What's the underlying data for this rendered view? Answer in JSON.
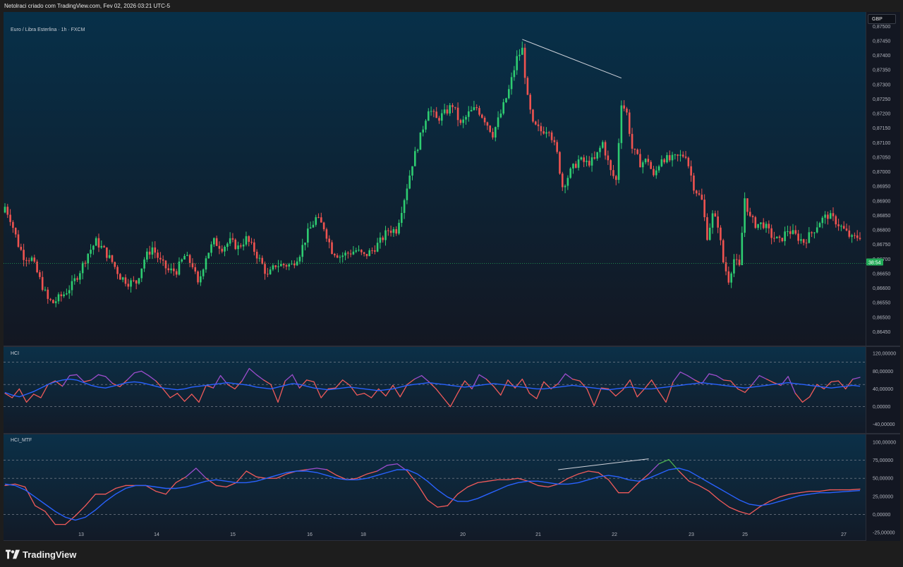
{
  "header": {
    "snapshot_text": "Netolraci criado com TradingView.com, Fev 02, 2026 03:21 UTC-5",
    "symbol_text": "Euro / Libra Esterlina · 1h · FXCM",
    "currency": "GBP"
  },
  "brand": {
    "name": "TradingView",
    "icon": "tradingview-logo-icon"
  },
  "colors": {
    "up": "#26a69a",
    "up_bright": "#2ecc71",
    "down": "#ef5350",
    "hci_line": "#f05a5a",
    "hci_purple": "#9c4dcc",
    "hci_green": "#4caf50",
    "signal_blue": "#2962ff",
    "price_label_bg": "#22ab58"
  },
  "chart_data": [
    {
      "type": "candlestick",
      "title": "Euro / Libra Esterlina · 1h · FXCM",
      "ylabel": "GBP",
      "ylim": [
        0.8641,
        0.8752
      ],
      "y_ticks": [
        "0,87500",
        "0,87450",
        "0,87400",
        "0,87350",
        "0,87300",
        "0,87250",
        "0,87200",
        "0,87150",
        "0,87100",
        "0,87050",
        "0,87000",
        "0,86950",
        "0,86900",
        "0,86850",
        "0,86800",
        "0,86750",
        "0,86700",
        "0,86650",
        "0,86600",
        "0,86550",
        "0,86500",
        "0,86450"
      ],
      "x_ticks": [
        "13",
        "14",
        "15",
        "16",
        "18",
        "20",
        "21",
        "22",
        "23",
        "25",
        "27"
      ],
      "current_price_line": 0.86685,
      "countdown_label": "38:54",
      "trendline": {
        "from": 0.87455,
        "to": 0.87322
      },
      "anchor_closes": [
        [
          0,
          0.8688
        ],
        [
          2,
          0.8684
        ],
        [
          5,
          0.8675
        ],
        [
          7,
          0.8671
        ],
        [
          10,
          0.867
        ],
        [
          13,
          0.8663
        ],
        [
          16,
          0.8656
        ],
        [
          18,
          0.8655
        ],
        [
          22,
          0.8658
        ],
        [
          25,
          0.8661
        ],
        [
          28,
          0.8666
        ],
        [
          31,
          0.8672
        ],
        [
          34,
          0.8676
        ],
        [
          37,
          0.8673
        ],
        [
          40,
          0.8669
        ],
        [
          43,
          0.8664
        ],
        [
          46,
          0.8662
        ],
        [
          49,
          0.8662
        ],
        [
          52,
          0.867
        ],
        [
          55,
          0.8674
        ],
        [
          58,
          0.8669
        ],
        [
          61,
          0.8666
        ],
        [
          64,
          0.8666
        ],
        [
          67,
          0.8671
        ],
        [
          70,
          0.8668
        ],
        [
          72,
          0.8661
        ],
        [
          75,
          0.8671
        ],
        [
          78,
          0.8676
        ],
        [
          81,
          0.8674
        ],
        [
          84,
          0.8676
        ],
        [
          87,
          0.8674
        ],
        [
          90,
          0.8677
        ],
        [
          93,
          0.8673
        ],
        [
          96,
          0.8668
        ],
        [
          98,
          0.8664
        ],
        [
          101,
          0.8668
        ],
        [
          104,
          0.8668
        ],
        [
          107,
          0.8668
        ],
        [
          110,
          0.8672
        ],
        [
          113,
          0.8679
        ],
        [
          116,
          0.8684
        ],
        [
          119,
          0.8681
        ],
        [
          122,
          0.8673
        ],
        [
          125,
          0.8671
        ],
        [
          128,
          0.8672
        ],
        [
          131,
          0.8673
        ],
        [
          134,
          0.8671
        ],
        [
          137,
          0.8673
        ],
        [
          140,
          0.8676
        ],
        [
          143,
          0.868
        ],
        [
          146,
          0.868
        ],
        [
          149,
          0.8691
        ],
        [
          152,
          0.8703
        ],
        [
          155,
          0.8712
        ],
        [
          158,
          0.8722
        ],
        [
          161,
          0.8718
        ],
        [
          164,
          0.872
        ],
        [
          167,
          0.8723
        ],
        [
          170,
          0.8716
        ],
        [
          173,
          0.872
        ],
        [
          176,
          0.8722
        ],
        [
          179,
          0.8718
        ],
        [
          182,
          0.8713
        ],
        [
          185,
          0.872
        ],
        [
          188,
          0.8728
        ],
        [
          191,
          0.8739
        ],
        [
          193,
          0.8742
        ],
        [
          195,
          0.8725
        ],
        [
          197,
          0.8716
        ],
        [
          200,
          0.8714
        ],
        [
          203,
          0.8715
        ],
        [
          206,
          0.8706
        ],
        [
          208,
          0.8695
        ],
        [
          211,
          0.87
        ],
        [
          214,
          0.8704
        ],
        [
          217,
          0.8703
        ],
        [
          220,
          0.8704
        ],
        [
          223,
          0.871
        ],
        [
          226,
          0.87
        ],
        [
          228,
          0.8697
        ],
        [
          230,
          0.8724
        ],
        [
          232,
          0.872
        ],
        [
          234,
          0.8708
        ],
        [
          237,
          0.8703
        ],
        [
          240,
          0.8704
        ],
        [
          242,
          0.8698
        ],
        [
          245,
          0.8705
        ],
        [
          248,
          0.8704
        ],
        [
          251,
          0.8705
        ],
        [
          254,
          0.8706
        ],
        [
          257,
          0.8695
        ],
        [
          260,
          0.869
        ],
        [
          262,
          0.8678
        ],
        [
          264,
          0.8685
        ],
        [
          266,
          0.8682
        ],
        [
          268,
          0.8669
        ],
        [
          270,
          0.8663
        ],
        [
          272,
          0.867
        ],
        [
          274,
          0.8667
        ],
        [
          276,
          0.8691
        ],
        [
          278,
          0.8684
        ],
        [
          280,
          0.8682
        ],
        [
          283,
          0.8682
        ],
        [
          286,
          0.8678
        ],
        [
          289,
          0.8676
        ],
        [
          292,
          0.868
        ],
        [
          295,
          0.8678
        ],
        [
          298,
          0.8676
        ],
        [
          301,
          0.8679
        ],
        [
          304,
          0.8683
        ],
        [
          307,
          0.8685
        ],
        [
          310,
          0.8683
        ],
        [
          313,
          0.868
        ],
        [
          316,
          0.8677
        ],
        [
          319,
          0.8678
        ]
      ]
    },
    {
      "type": "line",
      "title": "HCI",
      "ylim": [
        -50,
        125
      ],
      "y_ticks": [
        "120,00000",
        "80,00000",
        "40,00000",
        "0,00000",
        "-40,00000"
      ],
      "levels": [
        100,
        50,
        0
      ],
      "series": [
        {
          "name": "",
          "color": "#f05a5a",
          "values": [
            30,
            20,
            40,
            10,
            28,
            20,
            50,
            58,
            46,
            70,
            72,
            56,
            60,
            72,
            68,
            52,
            45,
            60,
            76,
            80,
            70,
            58,
            40,
            20,
            30,
            12,
            28,
            10,
            48,
            42,
            70,
            50,
            40,
            58,
            86,
            72,
            60,
            50,
            10,
            58,
            72,
            42,
            60,
            56,
            20,
            40,
            42,
            60,
            48,
            26,
            30,
            20,
            40,
            24,
            48,
            22,
            50,
            62,
            70,
            56,
            40,
            20,
            0,
            30,
            58,
            40,
            72,
            62,
            46,
            26,
            60,
            42,
            62,
            30,
            18,
            56,
            40,
            52,
            74,
            62,
            58,
            40,
            2,
            42,
            40,
            24,
            38,
            60,
            22,
            40,
            60,
            34,
            10,
            56,
            78,
            70,
            60,
            52,
            74,
            70,
            60,
            58,
            40,
            32,
            50,
            70,
            62,
            54,
            48,
            68,
            30,
            10,
            22,
            50,
            40,
            56,
            58,
            40,
            62,
            66
          ]
        },
        {
          "name": "",
          "color": "#2962ff",
          "values": [
            32,
            26,
            22,
            28,
            34,
            42,
            50,
            56,
            60,
            62,
            60,
            54,
            48,
            44,
            42,
            46,
            50,
            54,
            56,
            54,
            50,
            46,
            42,
            40,
            38,
            40,
            44,
            46,
            48,
            50,
            52,
            54,
            52,
            50,
            48,
            44,
            42,
            40,
            44,
            48,
            52,
            50,
            46,
            42,
            40,
            38,
            40,
            42,
            44,
            42,
            40,
            38,
            36,
            38,
            40,
            44,
            48,
            50,
            52,
            54,
            52,
            50,
            48,
            46,
            44,
            46,
            48,
            50,
            52,
            50,
            48,
            46,
            44,
            42,
            40,
            40,
            42,
            44,
            46,
            48,
            46,
            44,
            42,
            40,
            38,
            40,
            42,
            44,
            42,
            40,
            40,
            42,
            44,
            46,
            48,
            50,
            52,
            54,
            52,
            50,
            48,
            46,
            44,
            42,
            44,
            46,
            48,
            50,
            52,
            54,
            52,
            50,
            48,
            46,
            44,
            42,
            44,
            46,
            48,
            46
          ]
        }
      ]
    },
    {
      "type": "line",
      "title": "HCI_MTF",
      "ylim": [
        -30,
        105
      ],
      "y_ticks": [
        "100,00000",
        "75,00000",
        "50,00000",
        "25,00000",
        "0,00000",
        "-25,00000"
      ],
      "levels": [
        75,
        50,
        0
      ],
      "series": [
        {
          "name": "",
          "color": "#f05a5a",
          "values": [
            40,
            42,
            38,
            12,
            4,
            -14,
            -14,
            -2,
            12,
            28,
            28,
            36,
            40,
            40,
            40,
            32,
            28,
            44,
            52,
            64,
            50,
            40,
            38,
            44,
            60,
            52,
            50,
            50,
            56,
            60,
            62,
            64,
            62,
            54,
            48,
            50,
            56,
            60,
            68,
            70,
            60,
            42,
            20,
            10,
            12,
            28,
            38,
            44,
            46,
            48,
            48,
            50,
            46,
            40,
            38,
            42,
            50,
            56,
            60,
            58,
            48,
            30,
            30,
            44,
            56,
            70,
            76,
            60,
            46,
            40,
            32,
            20,
            10,
            4,
            0,
            10,
            18,
            24,
            28,
            30,
            32,
            32,
            34,
            34,
            34,
            35
          ]
        },
        {
          "name": "",
          "color": "#2962ff",
          "values": [
            42,
            40,
            34,
            24,
            14,
            4,
            -4,
            -8,
            -4,
            6,
            18,
            28,
            36,
            40,
            40,
            38,
            36,
            36,
            38,
            42,
            46,
            48,
            46,
            44,
            44,
            46,
            50,
            54,
            58,
            60,
            60,
            58,
            54,
            50,
            48,
            48,
            50,
            54,
            58,
            62,
            62,
            56,
            46,
            34,
            24,
            18,
            18,
            22,
            28,
            34,
            40,
            44,
            46,
            46,
            44,
            42,
            42,
            44,
            48,
            52,
            54,
            52,
            48,
            46,
            50,
            56,
            62,
            64,
            60,
            52,
            44,
            36,
            28,
            20,
            14,
            12,
            14,
            18,
            22,
            26,
            28,
            30,
            30,
            31,
            32,
            33
          ]
        }
      ],
      "trendline": {
        "from": 62,
        "to": 77
      }
    }
  ]
}
